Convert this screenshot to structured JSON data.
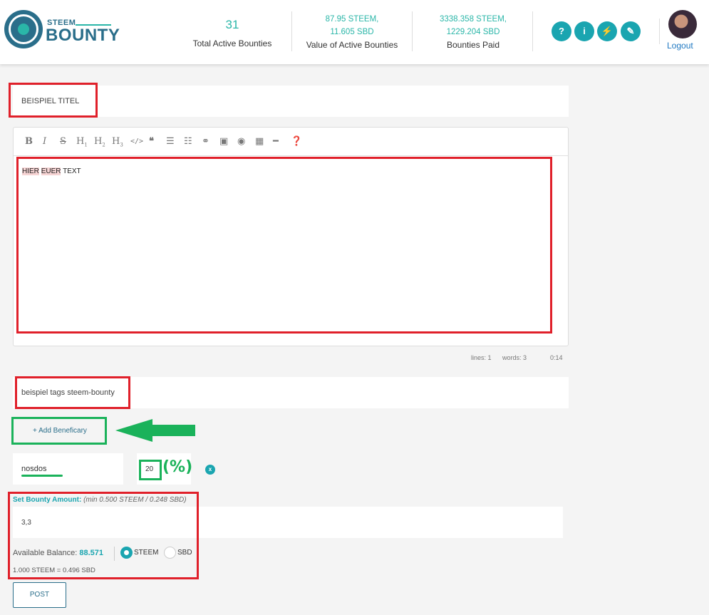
{
  "header": {
    "logo_small": "STEEM",
    "logo_big": "BOUNTY",
    "stats": [
      {
        "value": "31",
        "label": "Total Active Bounties"
      },
      {
        "value_line1": "87.95 STEEM,",
        "value_line2": "11.605 SBD",
        "label": "Value of Active Bounties"
      },
      {
        "value_line1": "3338.358 STEEM,",
        "value_line2": "1229.204 SBD",
        "label": "Bounties Paid"
      }
    ],
    "buttons": [
      "?",
      "i",
      "⚡",
      "✎"
    ],
    "logout": "Logout"
  },
  "form": {
    "title_value": "BEISPIEL TITEL",
    "editor_hl1": "HIER",
    "editor_hl2": "EUER",
    "editor_rest": "TEXT",
    "status": {
      "lines": "lines: 1",
      "words": "words: 3",
      "time": "0:14"
    },
    "tags_value": "beispiel tags steem-bounty",
    "add_beneficiary": "+ Add Beneficary",
    "beneficiary_user": "nosdos",
    "beneficiary_pct": "20",
    "pct_symbol": "(%)",
    "remove": "x",
    "amount_label": "Set Bounty Amount:",
    "amount_hint": "(min 0.500 STEEM / 0.248 SBD)",
    "amount_value": "3,3",
    "balance_label": "Available Balance:",
    "balance_value": "88.571",
    "currency_steem": "STEEM",
    "currency_sbd": "SBD",
    "rate": "1.000 STEEM = 0.496 SBD",
    "post": "POST"
  },
  "colors": {
    "accent": "#1aa5b0",
    "brand": "#2a6e8a",
    "annotation_red": "#e0202a",
    "annotation_green": "#1ab25a"
  }
}
